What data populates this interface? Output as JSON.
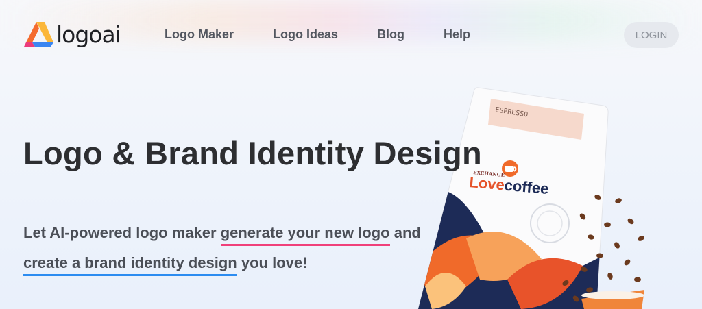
{
  "brand": {
    "name": "logoai"
  },
  "nav": [
    {
      "label": "Logo Maker"
    },
    {
      "label": "Logo Ideas"
    },
    {
      "label": "Blog"
    },
    {
      "label": "Help"
    }
  ],
  "login_label": "LOGIN",
  "hero": {
    "title": "Logo & Brand Identity Design",
    "subtitle": {
      "part1": "Let AI-powered logo maker ",
      "highlight1": "generate your new logo",
      "part2": " and ",
      "highlight2": "create a brand identity design",
      "part3": " you love!"
    }
  },
  "product": {
    "label_top": "ESPRESSO",
    "brand_small": "EXCHANGE",
    "brand_big": "Love",
    "brand_big2": "coffee",
    "icon": "coffee-cup-icon"
  },
  "colors": {
    "pink": "#f0407a",
    "blue": "#2c8cf0",
    "orange": "#f06a2a",
    "navy": "#1d2b57"
  }
}
